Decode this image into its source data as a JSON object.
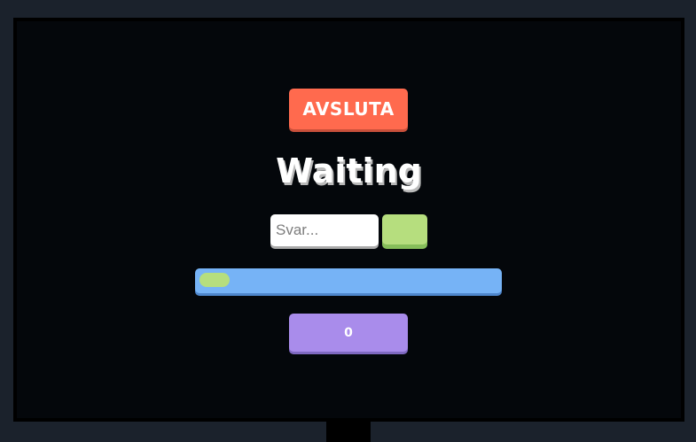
{
  "controls": {
    "quit_label": "AVSLUTA"
  },
  "status": {
    "title": "Waiting"
  },
  "answer": {
    "value": "",
    "placeholder": "Svar..."
  },
  "progress": {
    "fraction": 0.1
  },
  "score": {
    "value": "0"
  },
  "colors": {
    "quit": "#ff6a4e",
    "submit": "#b6de7e",
    "progress_track": "#76b3f6",
    "progress_fill": "#b6de7e",
    "score": "#a98ceb",
    "background": "#1b222c",
    "screen": "#04070b"
  }
}
